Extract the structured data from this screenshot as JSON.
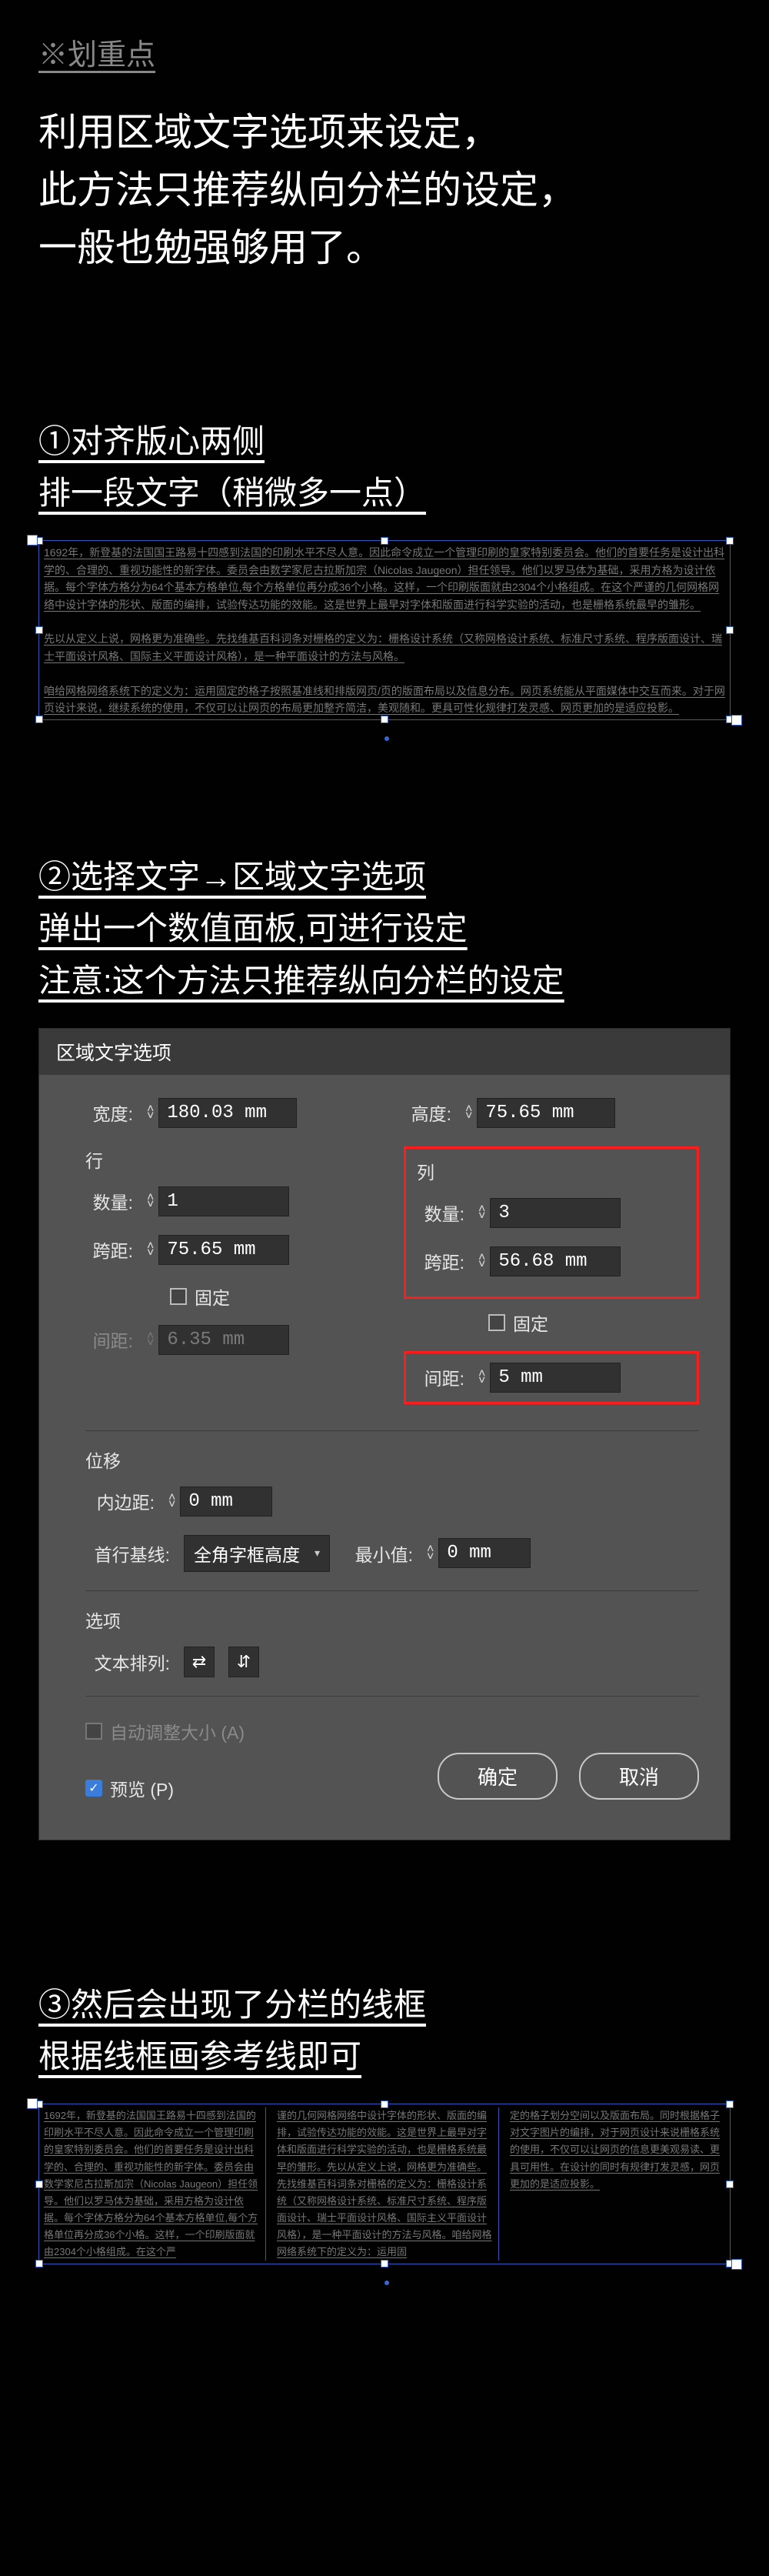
{
  "header": {
    "tag": "※划重点"
  },
  "intro": {
    "line1": "利用区域文字选项来设定，",
    "line2": "此方法只推荐纵向分栏的设定，",
    "line3": "一般也勉强够用了。"
  },
  "step1": {
    "h1": "①对齐版心两侧",
    "h2": "排一段文字（稍微多一点）",
    "body": "1692年，新登基的法国国王路易十四感到法国的印刷水平不尽人意。因此命令成立一个管理印刷的皇家特别委员会。他们的首要任务是设计出科学的、合理的、重视功能性的新字体。委员会由数学家尼古拉斯加宗（Nicolas Jaugeon）担任领导。他们以罗马体为基础，采用方格为设计依据。每个字体方格分为64个基本方格单位,每个方格单位再分成36个小格。这样，一个印刷版面就由2304个小格组成。在这个严谨的几何网格网络中设计字体的形状、版面的编排，试验传达功能的效能。这是世界上最早对字体和版面进行科学实验的活动，也是栅格系统最早的雏形。\n\n先以从定义上说，网格更为准确些。先找维基百科词条对栅格的定义为：栅格设计系统（又称网格设计系统、标准尺寸系统、程序版面设计、瑞士平面设计风格、国际主义平面设计风格），是一种平面设计的方法与风格。\n\n咱给网格网络系统下的定义为：运用固定的格子按照基准线和排版网页/页的版面布局以及信息分布。网页系统能从平面媒体中交互而来。对于网页设计来说，继续系统的使用，不仅可以让网页的布局更加整齐简洁，美观随和。更具可性化规律打发灵感、网页更加的是适应投影。"
  },
  "step2": {
    "h1": "②选择文字→区域文字选项",
    "h2": "弹出一个数值面板,可进行设定",
    "h3": "注意:这个方法只推荐纵向分栏的设定"
  },
  "dialog": {
    "title": "区域文字选项",
    "width_lbl": "宽度:",
    "width_val": "180.03 mm",
    "height_lbl": "高度:",
    "height_val": "75.65 mm",
    "row_group": "行",
    "col_group": "列",
    "qty_lbl": "数量:",
    "span_lbl": "跨距:",
    "gap_lbl": "间距:",
    "row_qty": "1",
    "row_span": "75.65 mm",
    "row_gap": "6.35 mm",
    "col_qty": "3",
    "col_span": "56.68 mm",
    "col_gap": "5 mm",
    "fixed": "固定",
    "offset_group": "位移",
    "inset_lbl": "内边距:",
    "inset_val": "0 mm",
    "baseline_lbl": "首行基线:",
    "baseline_val": "全角字框高度",
    "min_lbl": "最小值:",
    "min_val": "0 mm",
    "options_group": "选项",
    "textflow_lbl": "文本排列:",
    "auto_resize": "自动调整大小 (A)",
    "preview": "预览 (P)",
    "ok": "确定",
    "cancel": "取消"
  },
  "step3": {
    "h1": "③然后会出现了分栏的线框",
    "h2": "根据线框画参考线即可",
    "col1": "1692年，新登基的法国国王路易十四感到法国的印刷水平不尽人意。因此命令成立一个管理印刷的皇家特别委员会。他们的首要任务是设计出科学的、合理的、重视功能性的新字体。委员会由数学家尼古拉斯加宗（Nicolas Jaugeon）担任领导。他们以罗马体为基础，采用方格为设计依据。每个字体方格分为64个基本方格单位,每个方格单位再分成36个小格。这样，一个印刷版面就由2304个小格组成。在这个严",
    "col2": "谨的几何网格网络中设计字体的形状、版面的编排，试验传达功能的效能。这是世界上最早对字体和版面进行科学实验的活动，也是栅格系统最早的雏形。先以从定义上说，网格更为准确些。先找维基百科词条对栅格的定义为：栅格设计系统（又称网格设计系统、标准尺寸系统、程序版面设计、瑞士平面设计风格、国际主义平面设计风格），是一种平面设计的方法与风格。咱给网格网络系统下的定义为：运用固",
    "col3": "定的格子划分空间以及版面布局。同时根据格子对文字图片的编排，对于网页设计来说栅格系统的使用，不仅可以让网页的信息更美观易读、更具可用性。在设计的同时有规律打发灵感，网页更加的是适应投影。"
  }
}
